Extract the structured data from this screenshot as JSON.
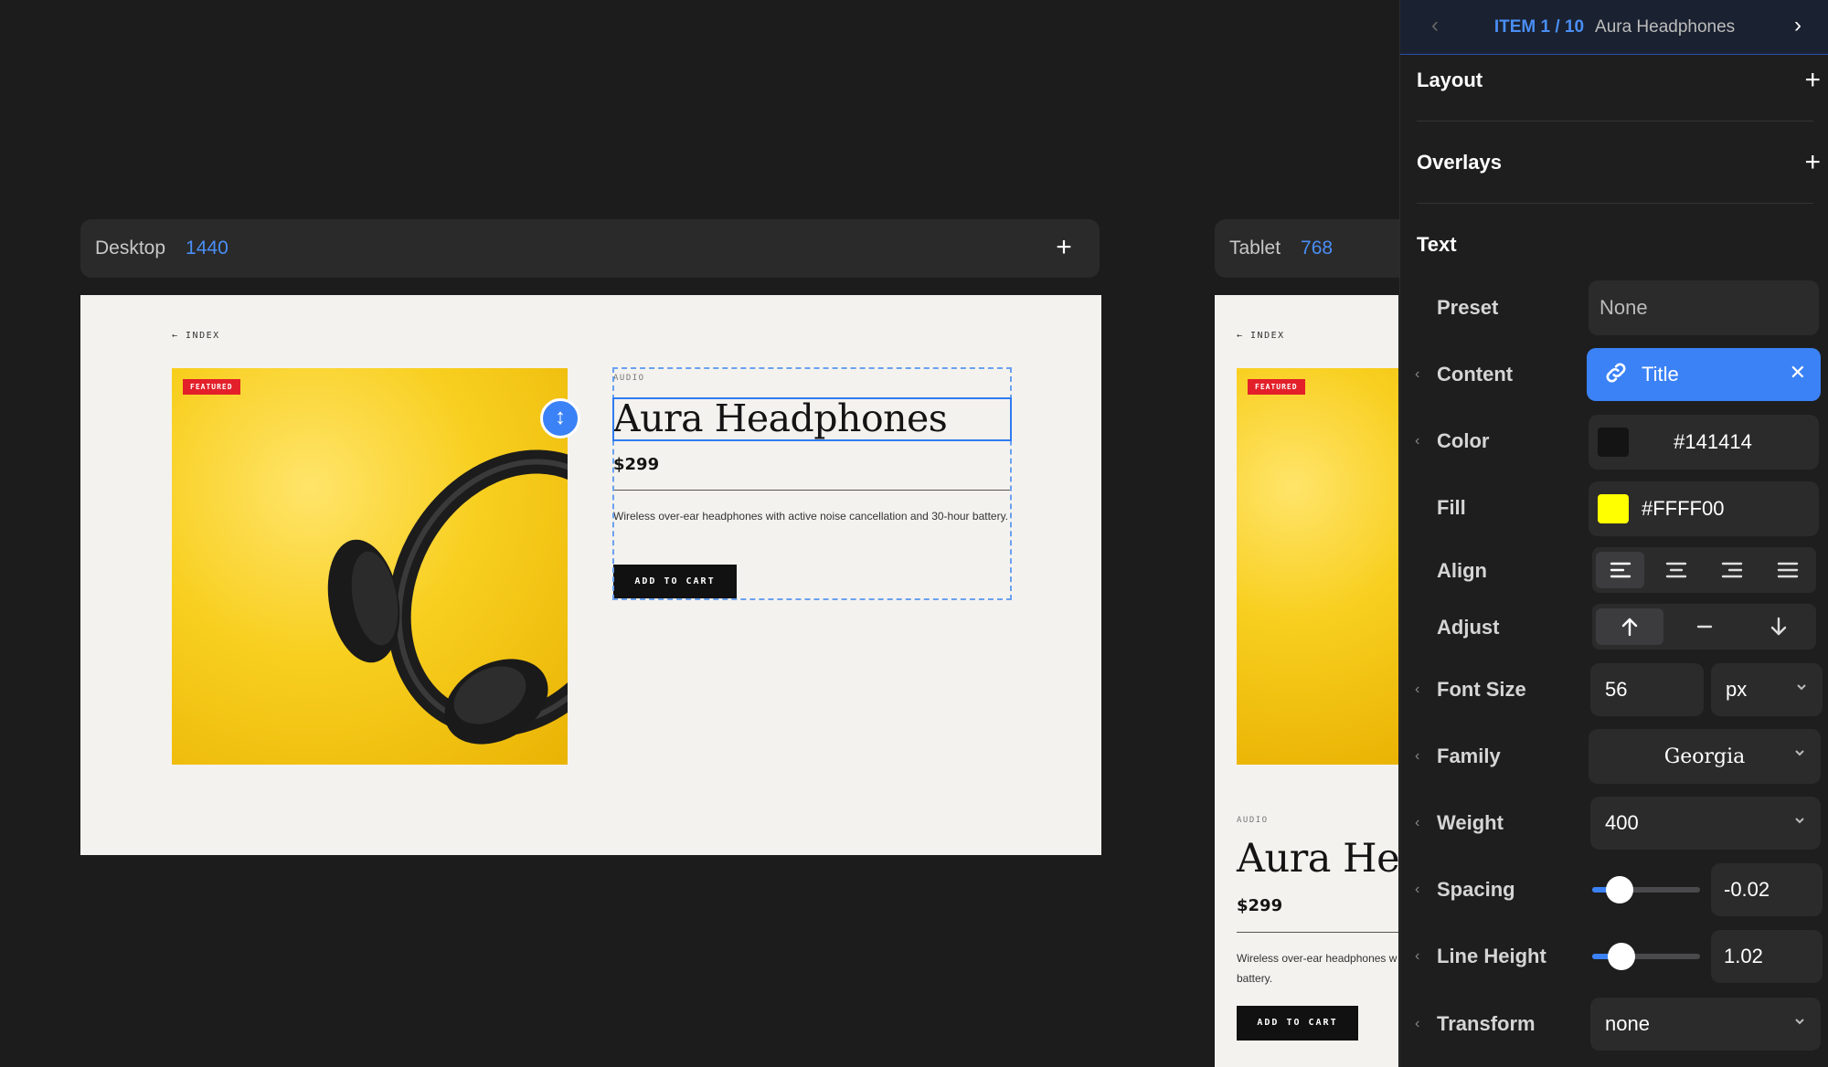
{
  "canvas": {
    "desktop": {
      "name": "Desktop",
      "width": "1440",
      "add": "+"
    },
    "tablet": {
      "name": "Tablet",
      "width": "768"
    }
  },
  "product": {
    "back": "← INDEX",
    "badge": "FEATURED",
    "category": "AUDIO",
    "title": "Aura Headphones",
    "price": "$299",
    "description": "Wireless over-ear headphones with active noise cancellation and 30-hour battery.",
    "description_tablet_line1": "Wireless over-ear headphones w",
    "description_tablet_line2": "battery.",
    "cart": "ADD TO CART"
  },
  "panel": {
    "pager": {
      "item": "ITEM 1 / 10",
      "name": "Aura Headphones"
    },
    "sections": {
      "layout": "Layout",
      "overlays": "Overlays",
      "text": "Text"
    },
    "rows": {
      "preset": {
        "label": "Preset",
        "value": "None"
      },
      "content": {
        "label": "Content",
        "value": "Title"
      },
      "color": {
        "label": "Color",
        "value": "#141414",
        "swatch": "#141414"
      },
      "fill": {
        "label": "Fill",
        "value": "#FFFF00",
        "swatch": "#FFFF00"
      },
      "align": {
        "label": "Align",
        "active": "left"
      },
      "adjust": {
        "label": "Adjust",
        "active": "top"
      },
      "font_size": {
        "label": "Font Size",
        "value": "56",
        "unit": "px"
      },
      "family": {
        "label": "Family",
        "value": "Georgia"
      },
      "weight": {
        "label": "Weight",
        "value": "400"
      },
      "spacing": {
        "label": "Spacing",
        "value": "-0.02",
        "slider_fraction": 0.25
      },
      "line_height": {
        "label": "Line Height",
        "value": "1.02",
        "slider_fraction": 0.27
      },
      "transform": {
        "label": "Transform",
        "value": "none"
      }
    }
  },
  "colors": {
    "accent": "#3B82F6",
    "badge": "#E3202A",
    "product_bg": "#F8CF1F"
  }
}
